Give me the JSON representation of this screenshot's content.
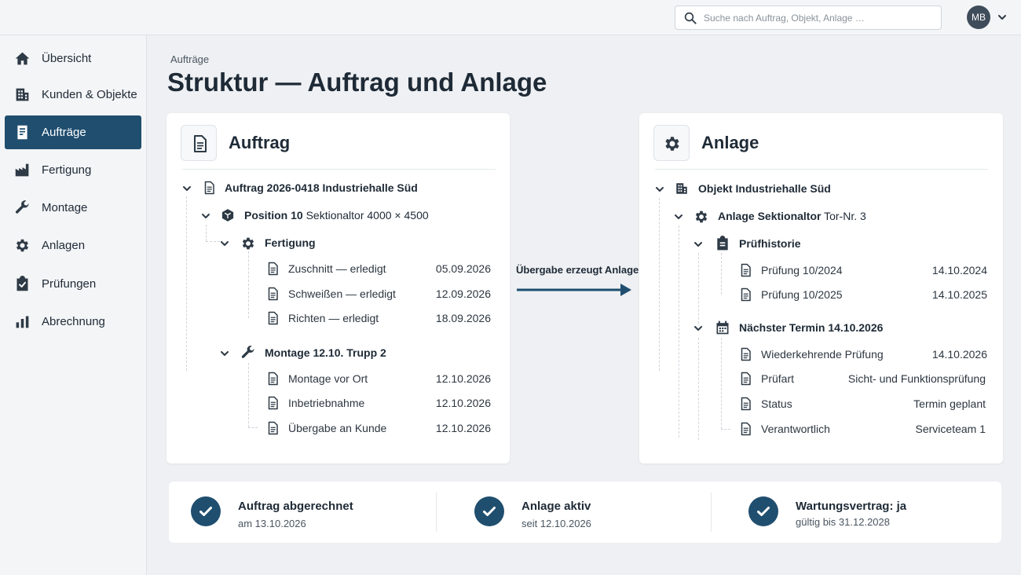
{
  "search": {
    "placeholder": "Suche nach Auftrag, Objekt, Anlage …"
  },
  "user": {
    "initials": "MB"
  },
  "sidebar": {
    "items": [
      {
        "label": "Übersicht",
        "icon": "home-icon"
      },
      {
        "label": "Kunden & Objekte",
        "icon": "building-icon"
      },
      {
        "label": "Aufträge",
        "icon": "document-icon",
        "active": true
      },
      {
        "label": "Fertigung",
        "icon": "factory-icon"
      },
      {
        "label": "Montage",
        "icon": "wrench-icon"
      },
      {
        "label": "Anlagen",
        "icon": "gear-icon"
      },
      {
        "label": "Prüfungen",
        "icon": "clipboard-check-icon"
      },
      {
        "label": "Abrechnung",
        "icon": "bar-chart-icon"
      }
    ]
  },
  "breadcrumb": "Aufträge",
  "page_title": "Struktur — Auftrag und Anlage",
  "auftrag": {
    "title": "Auftrag",
    "root_label": "Auftrag 2026-0418 Industriehalle Süd",
    "position": {
      "bold": "Position 10",
      "rest": "Sektionaltor 4000 × 4500"
    },
    "fertigung": {
      "label": "Fertigung",
      "items": [
        {
          "label": "Zuschnitt — erledigt",
          "date": "05.09.2026"
        },
        {
          "label": "Schweißen — erledigt",
          "date": "12.09.2026"
        },
        {
          "label": "Richten — erledigt",
          "date": "18.09.2026"
        }
      ]
    },
    "montage": {
      "label": "Montage 12.10. Trupp 2",
      "items": [
        {
          "label": "Montage vor Ort",
          "date": "12.10.2026"
        },
        {
          "label": "Inbetriebnahme",
          "date": "12.10.2026"
        },
        {
          "label": "Übergabe an Kunde",
          "date": "12.10.2026"
        }
      ]
    }
  },
  "connector": {
    "label": "Übergabe erzeugt Anlage"
  },
  "anlage": {
    "title": "Anlage",
    "root_label": "Objekt Industriehalle Süd",
    "anlage_item": {
      "bold": "Anlage Sektionaltor",
      "rest": "Tor-Nr. 3"
    },
    "pruefhistorie": {
      "label": "Prüfhistorie",
      "items": [
        {
          "label": "Prüfung 10/2024",
          "date": "14.10.2024"
        },
        {
          "label": "Prüfung 10/2025",
          "date": "14.10.2025"
        }
      ]
    },
    "termin": {
      "label": "Nächster Termin 14.10.2026",
      "items": [
        {
          "label": "Wiederkehrende Prüfung",
          "value": "14.10.2026"
        },
        {
          "label": "Prüfart",
          "value": "Sicht- und Funktionsprüfung"
        },
        {
          "label": "Status",
          "value": "Termin geplant"
        },
        {
          "label": "Verantwortlich",
          "value": "Serviceteam 1"
        }
      ]
    }
  },
  "status": [
    {
      "title": "Auftrag abgerechnet",
      "sub": "am 13.10.2026"
    },
    {
      "title": "Anlage aktiv",
      "sub": "seit 12.10.2026"
    },
    {
      "title": "Wartungsvertrag: ja",
      "sub": "gültig bis 31.12.2028"
    }
  ],
  "colors": {
    "accent": "#1f4e6f",
    "background": "#eef0f3",
    "text": "#1e2a36"
  }
}
